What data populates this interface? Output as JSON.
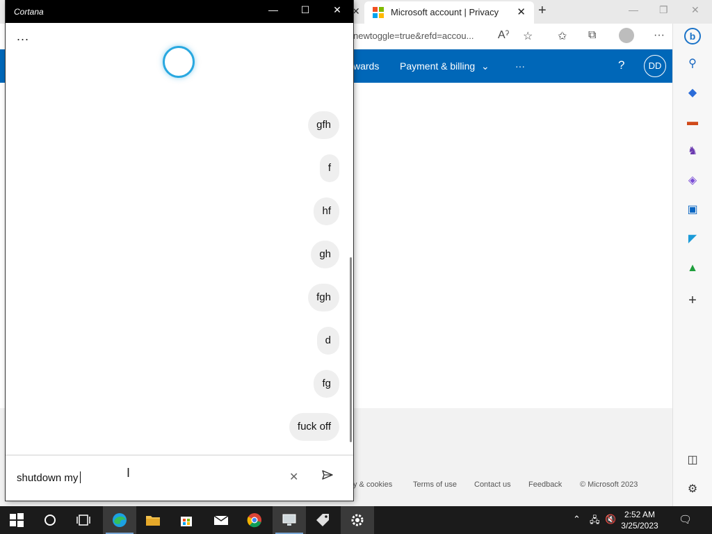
{
  "browser": {
    "tab_title": "Microsoft account | Privacy",
    "url": "newtoggle=true&refd=accou...",
    "nav_rewards": "wards",
    "nav_payment": "Payment & billing",
    "nav_more": "···",
    "help": "?",
    "avatar_initials": "DD",
    "footer": {
      "privacy": "y & cookies",
      "terms": "Terms of use",
      "contact": "Contact us",
      "feedback": "Feedback",
      "copyright": "© Microsoft 2023"
    },
    "sidebar_icons": [
      "bing-icon",
      "search-icon",
      "tag-icon",
      "toolbox-icon",
      "chess-icon",
      "office-icon",
      "outlook-icon",
      "send-icon",
      "tree-icon",
      "plus-icon",
      "split-screen-icon",
      "settings-icon"
    ]
  },
  "cortana": {
    "title": "Cortana",
    "more": "...",
    "messages": [
      "gfh",
      "f",
      "hf",
      "gh",
      "fgh",
      "d",
      "fg",
      "fuck off"
    ],
    "input_value": "shutdown my"
  },
  "taskbar": {
    "time": "2:52 AM",
    "date": "3/25/2023"
  },
  "colors": {
    "ms_blue": "#0067b8",
    "cortana_ring": "#29a8e0"
  }
}
